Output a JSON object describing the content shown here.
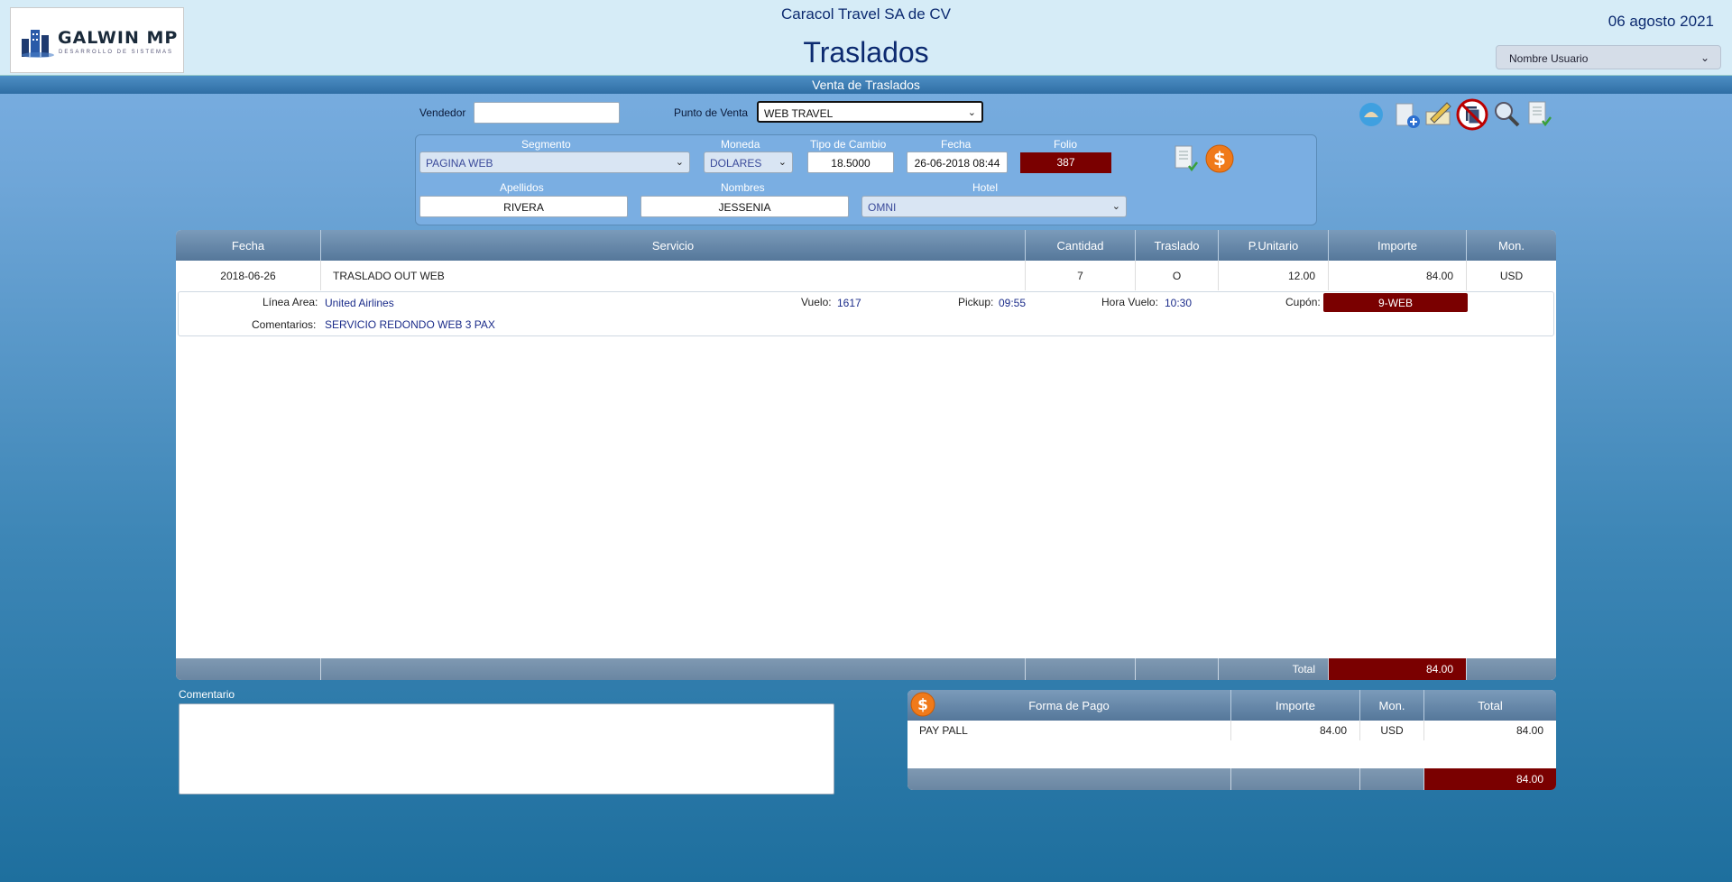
{
  "header": {
    "company": "Caracol Travel SA de CV",
    "title": "Traslados",
    "date": "06 agosto 2021",
    "user_dropdown": "Nombre Usuario",
    "logo_brand": "GALWIN MP",
    "logo_sub": "DESARROLLO DE SISTEMAS"
  },
  "subbar": {
    "title": "Venta de Traslados"
  },
  "top": {
    "vendedor_label": "Vendedor",
    "vendedor_value": "",
    "punto_label": "Punto de Venta",
    "punto_value": "WEB TRAVEL"
  },
  "form": {
    "segmento_label": "Segmento",
    "segmento_value": "PAGINA WEB",
    "moneda_label": "Moneda",
    "moneda_value": "DOLARES",
    "tipo_cambio_label": "Tipo de Cambio",
    "tipo_cambio_value": "18.5000",
    "fecha_label": "Fecha",
    "fecha_value": "26-06-2018 08:44",
    "folio_label": "Folio",
    "folio_value": "387",
    "apellidos_label": "Apellidos",
    "apellidos_value": "RIVERA",
    "nombres_label": "Nombres",
    "nombres_value": "JESSENIA",
    "hotel_label": "Hotel",
    "hotel_value": "OMNI"
  },
  "grid": {
    "headers": [
      "Fecha",
      "Servicio",
      "Cantidad",
      "Traslado",
      "P.Unitario",
      "Importe",
      "Mon."
    ],
    "row": {
      "fecha": "2018-06-26",
      "servicio": "TRASLADO OUT WEB",
      "cantidad": "7",
      "traslado": "O",
      "punitario": "12.00",
      "importe": "84.00",
      "mon": "USD"
    },
    "detail": {
      "linea_label": "Línea Area:",
      "linea_value": "United Airlines",
      "vuelo_label": "Vuelo:",
      "vuelo_value": "1617",
      "pickup_label": "Pickup:",
      "pickup_value": "09:55",
      "hora_label": "Hora Vuelo:",
      "hora_value": "10:30",
      "cupon_label": "Cupón:",
      "cupon_value": "9-WEB",
      "comentarios_label": "Comentarios:",
      "comentarios_value": "SERVICIO REDONDO WEB 3 PAX"
    },
    "total_label": "Total",
    "total_value": "84.00"
  },
  "comentario": {
    "label": "Comentario",
    "value": ""
  },
  "payment": {
    "headers": [
      "Forma de Pago",
      "Importe",
      "Mon.",
      "Total"
    ],
    "row": {
      "forma": "PAY PALL",
      "importe": "84.00",
      "mon": "USD",
      "total": "84.00"
    },
    "footer_total": "84.00"
  },
  "colors": {
    "accent_red": "#7a0000",
    "header_bg": "#d6ecf7",
    "title_blue": "#0c2a70"
  }
}
